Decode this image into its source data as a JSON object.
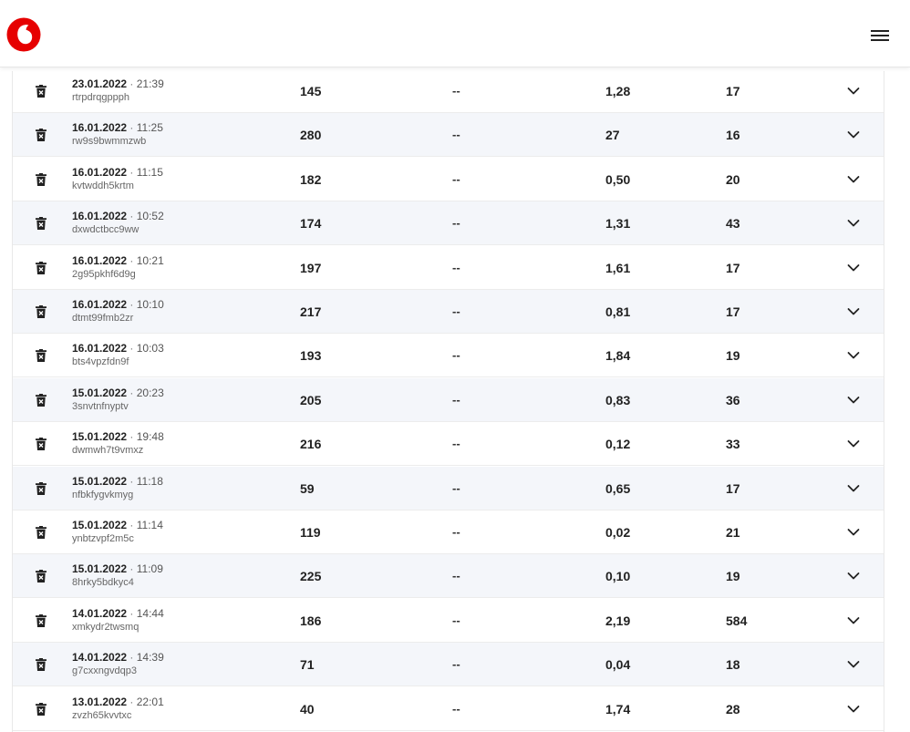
{
  "header": {
    "logo_icon": "vodafone-logo-icon",
    "menu_icon": "hamburger-menu-icon",
    "brand_color": "#e60000"
  },
  "rows": [
    {
      "date": "23.01.2022",
      "separator": "·",
      "time": "21:39",
      "code": "rtrpdrqgppph",
      "col1": "145",
      "col2": "--",
      "col3": "1,28",
      "col4": "17"
    },
    {
      "date": "16.01.2022",
      "separator": "·",
      "time": "11:25",
      "code": "rw9s9bwmmzwb",
      "col1": "280",
      "col2": "--",
      "col3": "27",
      "col4": "16"
    },
    {
      "date": "16.01.2022",
      "separator": "·",
      "time": "11:15",
      "code": "kvtwddh5krtm",
      "col1": "182",
      "col2": "--",
      "col3": "0,50",
      "col4": "20"
    },
    {
      "date": "16.01.2022",
      "separator": "·",
      "time": "10:52",
      "code": "dxwdctbcc9ww",
      "col1": "174",
      "col2": "--",
      "col3": "1,31",
      "col4": "43"
    },
    {
      "date": "16.01.2022",
      "separator": "·",
      "time": "10:21",
      "code": "2g95pkhf6d9g",
      "col1": "197",
      "col2": "--",
      "col3": "1,61",
      "col4": "17"
    },
    {
      "date": "16.01.2022",
      "separator": "·",
      "time": "10:10",
      "code": "dtmt99fmb2zr",
      "col1": "217",
      "col2": "--",
      "col3": "0,81",
      "col4": "17"
    },
    {
      "date": "16.01.2022",
      "separator": "·",
      "time": "10:03",
      "code": "bts4vpzfdn9f",
      "col1": "193",
      "col2": "--",
      "col3": "1,84",
      "col4": "19"
    },
    {
      "date": "15.01.2022",
      "separator": "·",
      "time": "20:23",
      "code": "3snvtnfnyptv",
      "col1": "205",
      "col2": "--",
      "col3": "0,83",
      "col4": "36"
    },
    {
      "date": "15.01.2022",
      "separator": "·",
      "time": "19:48",
      "code": "dwmwh7t9vmxz",
      "col1": "216",
      "col2": "--",
      "col3": "0,12",
      "col4": "33"
    },
    {
      "date": "15.01.2022",
      "separator": "·",
      "time": "11:18",
      "code": "nfbkfygvkmyg",
      "col1": "59",
      "col2": "--",
      "col3": "0,65",
      "col4": "17"
    },
    {
      "date": "15.01.2022",
      "separator": "·",
      "time": "11:14",
      "code": "ynbtzvpf2m5c",
      "col1": "119",
      "col2": "--",
      "col3": "0,02",
      "col4": "21"
    },
    {
      "date": "15.01.2022",
      "separator": "·",
      "time": "11:09",
      "code": "8hrky5bdkyc4",
      "col1": "225",
      "col2": "--",
      "col3": "0,10",
      "col4": "19"
    },
    {
      "date": "14.01.2022",
      "separator": "·",
      "time": "14:44",
      "code": "xmkydr2twsmq",
      "col1": "186",
      "col2": "--",
      "col3": "2,19",
      "col4": "584"
    },
    {
      "date": "14.01.2022",
      "separator": "·",
      "time": "14:39",
      "code": "g7cxxngvdqp3",
      "col1": "71",
      "col2": "--",
      "col3": "0,04",
      "col4": "18"
    },
    {
      "date": "13.01.2022",
      "separator": "·",
      "time": "22:01",
      "code": "zvzh65kvvtxc",
      "col1": "40",
      "col2": "--",
      "col3": "1,74",
      "col4": "28"
    }
  ],
  "row_icons": {
    "delete": "trash-icon",
    "expand": "chevron-down-icon"
  }
}
